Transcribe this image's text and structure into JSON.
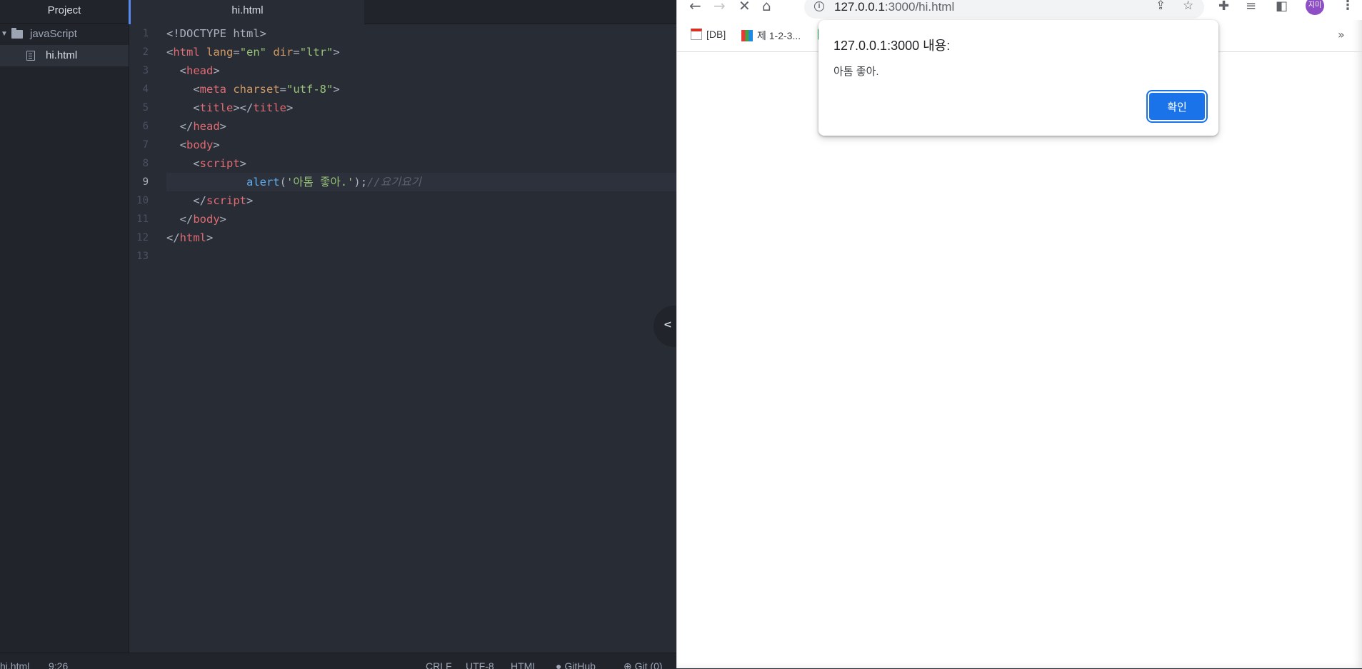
{
  "editor": {
    "tree": {
      "header": "Project",
      "folder": "javaScript",
      "file": "hi.html"
    },
    "tab_title": "hi.html",
    "line_numbers": [
      "1",
      "2",
      "3",
      "4",
      "5",
      "6",
      "7",
      "8",
      "9",
      "10",
      "11",
      "12",
      "13"
    ],
    "code": {
      "doctype": "<!DOCTYPE html>",
      "html_tag": "html",
      "attr_lang": "lang",
      "attr_lang_val": "\"en\"",
      "attr_dir": "dir",
      "attr_dir_val": "\"ltr\"",
      "head_tag": "head",
      "meta_tag": "meta",
      "attr_charset": "charset",
      "attr_charset_val": "\"utf-8\"",
      "title_tag": "title",
      "body_tag": "body",
      "script_tag": "script",
      "alert_fn": "alert",
      "alert_str": "'아톰 좋아.'",
      "alert_comment": "//요기요기"
    },
    "status": {
      "file": "hi.html",
      "cursor": "9:26",
      "line_ending": "CRLF",
      "encoding": "UTF-8",
      "grammar": "HTML",
      "github": "GitHub",
      "git": "Git (0)"
    }
  },
  "browser": {
    "url_host": "127.0.0.1",
    "url_path": ":3000/hi.html",
    "bookmarks": [
      "[DB]",
      "제 1-2-3..."
    ],
    "avatar_text": "지미",
    "dialog": {
      "title": "127.0.0.1:3000 내용:",
      "message": "아톰 좋아.",
      "ok_label": "확인"
    },
    "colors": {
      "accent": "#1a73e8",
      "avatar": "#8e4ec6"
    }
  }
}
